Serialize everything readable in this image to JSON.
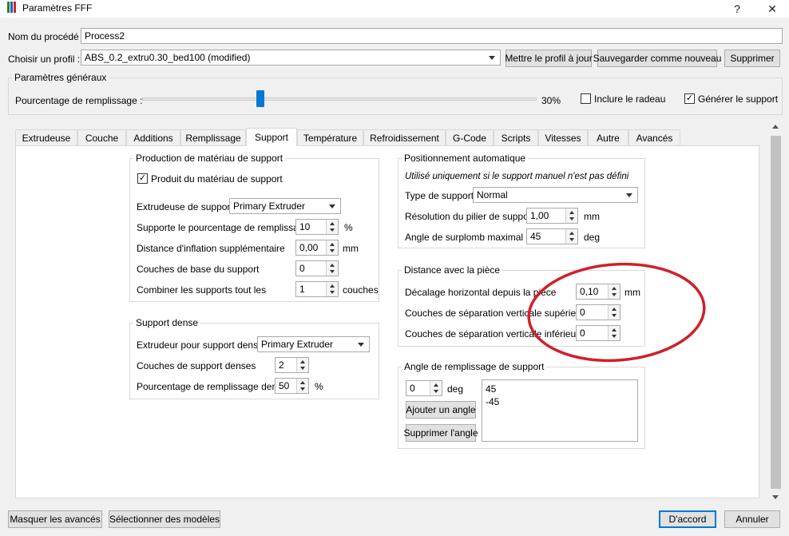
{
  "window": {
    "title": "Paramètres FFF",
    "help": "?",
    "close": "✕"
  },
  "process": {
    "label": "Nom du procédé :",
    "value": "Process2"
  },
  "profile": {
    "label": "Choisir un profil :",
    "selected": "ABS_0.2_extru0.30_bed100 (modified)",
    "update_button": "Mettre le profil à jour",
    "save_new_button": "Sauvegarder comme nouveau",
    "delete_button": "Supprimer"
  },
  "general": {
    "title": "Paramètres généraux",
    "infill_label": "Pourcentage de remplissage :",
    "infill_value_text": "30%",
    "infill_value": 0.3,
    "raft_label": "Inclure le radeau",
    "raft_checked": false,
    "support_label": "Générer le support",
    "support_checked": true
  },
  "tabs": [
    {
      "label": "Extrudeuse"
    },
    {
      "label": "Couche"
    },
    {
      "label": "Additions"
    },
    {
      "label": "Remplissage"
    },
    {
      "label": "Support"
    },
    {
      "label": "Température"
    },
    {
      "label": "Refroidissement"
    },
    {
      "label": "G-Code"
    },
    {
      "label": "Scripts"
    },
    {
      "label": "Vitesses"
    },
    {
      "label": "Autre"
    },
    {
      "label": "Avancés"
    }
  ],
  "active_tab": "Support",
  "support_material": {
    "title": "Production de matériau de support",
    "produce_label": "Produit du matériau de support",
    "produce_checked": true,
    "extruder_label": "Extrudeuse de support",
    "extruder_value": "Primary Extruder",
    "infill_pct_label": "Supporte le pourcentage de remplissage",
    "infill_pct_value": "10",
    "infill_pct_unit": "%",
    "inflation_label": "Distance d'inflation supplémentaire",
    "inflation_value": "0,00",
    "inflation_unit": "mm",
    "base_layers_label": "Couches de base du support",
    "base_layers_value": "0",
    "combine_label": "Combiner les supports tout les",
    "combine_value": "1",
    "combine_unit": "couches"
  },
  "dense_support": {
    "title": "Support dense",
    "extruder_label": "Extrudeur pour support dense",
    "extruder_value": "Primary Extruder",
    "layers_label": "Couches de support denses",
    "layers_value": "2",
    "infill_label": "Pourcentage de remplissage dense",
    "infill_value": "50",
    "infill_unit": "%"
  },
  "auto_placement": {
    "title": "Positionnement automatique",
    "note": "Utilisé uniquement si le support manuel n'est pas défini",
    "type_label": "Type de support",
    "type_value": "Normal",
    "resolution_label": "Résolution du pilier de support",
    "resolution_value": "1,00",
    "resolution_unit": "mm",
    "overhang_label": "Angle de surplomb maximal",
    "overhang_value": "45",
    "overhang_unit": "deg"
  },
  "part_distance": {
    "title": "Distance avec la pièce",
    "horizontal_label": "Décalage horizontal depuis la pièce",
    "horizontal_value": "0,10",
    "horizontal_unit": "mm",
    "upper_label": "Couches de séparation verticale supérieure",
    "upper_value": "0",
    "lower_label": "Couches de séparation verticale inférieure",
    "lower_value": "0"
  },
  "infill_angle": {
    "title": "Angle de remplissage de support",
    "angle_value": "0",
    "angle_unit": "deg",
    "add_button": "Ajouter un angle",
    "remove_button": "Supprimer l'angle",
    "angles": [
      "45",
      "-45"
    ]
  },
  "footer": {
    "hide_advanced": "Masquer les avancés",
    "select_models": "Sélectionner des modèles",
    "ok": "D'accord",
    "cancel": "Annuler"
  },
  "colors": {
    "annotation_circle": "#d0202a",
    "slider_handle": "#0078d7",
    "default_button_border": "#0078d7"
  }
}
